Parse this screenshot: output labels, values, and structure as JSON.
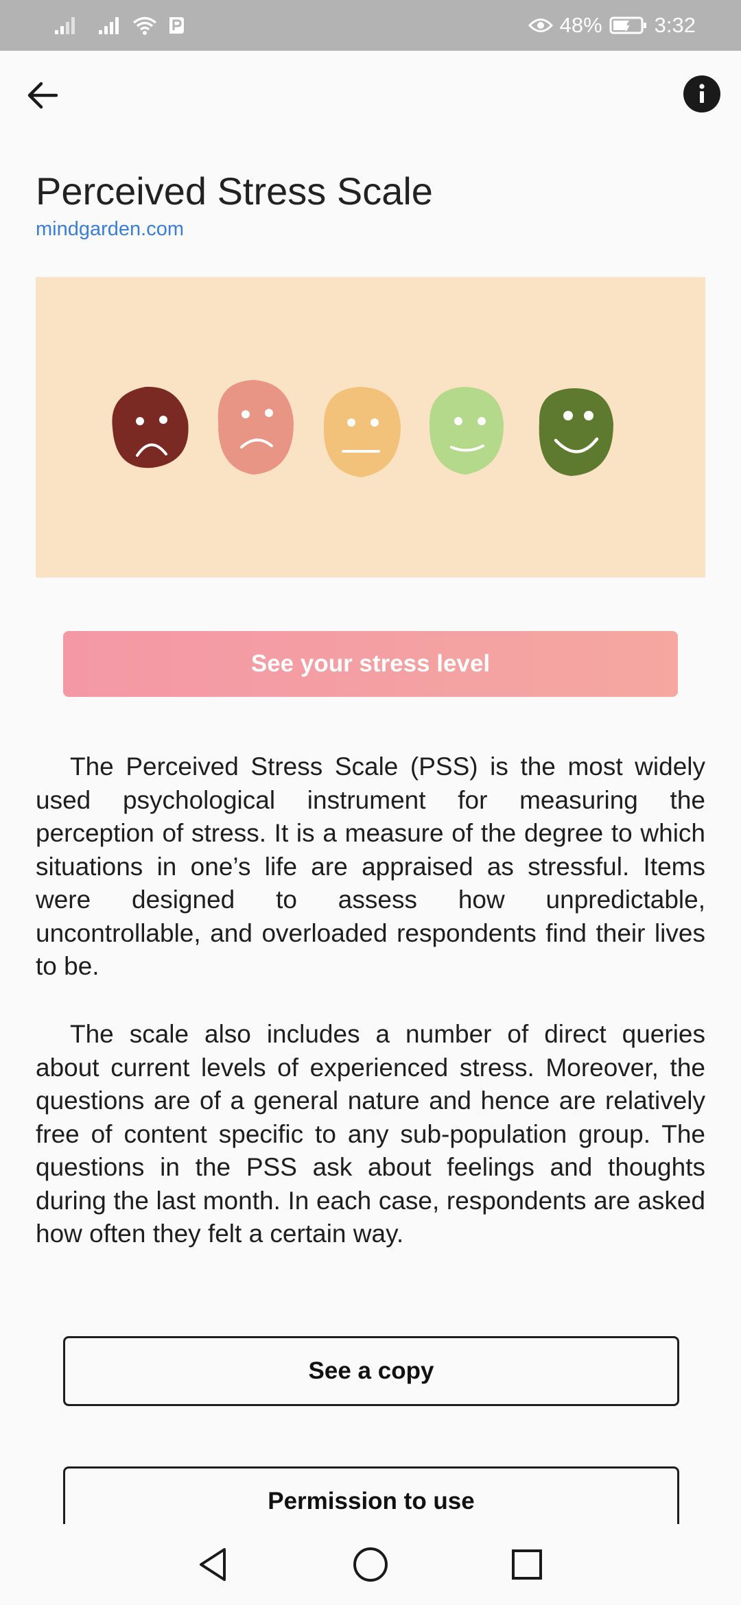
{
  "status_bar": {
    "battery_percent": "48%",
    "time": "3:32",
    "icons": [
      "signal-icon",
      "signal-icon",
      "wifi-icon",
      "parking-icon",
      "eye-icon",
      "battery-icon"
    ]
  },
  "app_bar": {
    "back_icon": "arrow-left-icon",
    "info_icon": "info-icon"
  },
  "page": {
    "title": "Perceived Stress Scale",
    "source": "mindgarden.com",
    "stress_button_label": "See your stress level",
    "paragraph_1": "The Perceived Stress Scale (PSS) is the most widely used psychological instrument for measuring the perception of stress. It is a measure of the degree to which situations in one’s life are appraised as stressful. Items were designed to assess how unpredictable, uncontrollable, and overloaded respondents find their lives to be.",
    "paragraph_2": "The scale also includes a number of direct queries about current levels of experienced stress. Moreover, the questions are of a general nature and hence are relatively free of content specific to any sub-population group. The questions in the PSS ask about feelings and thoughts during the last month. In each case, respondents are asked how often they felt a certain way.",
    "copy_button_label": "See a copy",
    "permission_button_label": "Permission to use"
  },
  "hero": {
    "faces": [
      "very-sad-face",
      "sad-face",
      "neutral-face",
      "smile-face",
      "happy-face"
    ],
    "colors": {
      "background": "#f9e3c4",
      "very_sad": "#7a2a22",
      "sad": "#e89585",
      "neutral": "#f3c27a",
      "smile": "#b5d98a",
      "happy": "#5e7a2e"
    }
  },
  "nav_bar": {
    "items": [
      "back-triangle-icon",
      "home-circle-icon",
      "recents-square-icon"
    ]
  }
}
